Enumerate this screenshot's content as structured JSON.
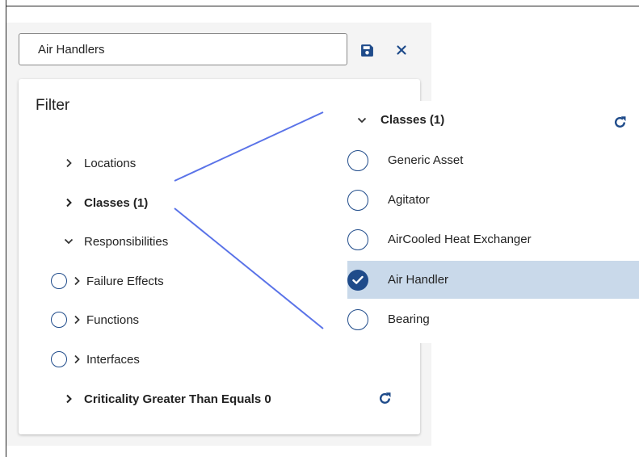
{
  "search": {
    "value": "Air Handlers"
  },
  "toolbar": {
    "save_icon": "save-icon",
    "close_icon": "close-icon"
  },
  "filter": {
    "title": "Filter",
    "items": [
      {
        "label": "Locations",
        "state": "collapsed"
      },
      {
        "label": "Classes (1)",
        "state": "collapsed",
        "bold": true
      },
      {
        "label": "Responsibilities",
        "state": "expanded"
      },
      {
        "label": "Failure Effects",
        "radio": true
      },
      {
        "label": "Functions",
        "radio": true
      },
      {
        "label": "Interfaces",
        "radio": true
      },
      {
        "label": "Criticality Greater Than Equals 0",
        "state": "collapsed",
        "bold": true
      }
    ]
  },
  "classes_popup": {
    "header": "Classes (1)",
    "options": [
      {
        "label": "Generic Asset",
        "selected": false
      },
      {
        "label": "Agitator",
        "selected": false
      },
      {
        "label": "AirCooled Heat Exchanger",
        "selected": false
      },
      {
        "label": "Air Handler",
        "selected": true
      },
      {
        "label": "Bearing",
        "selected": false
      }
    ]
  },
  "colors": {
    "accent": "#1f4b8a",
    "selected_row": "#c9d9ea",
    "connector": "#5a73e8",
    "panel_bg": "#f4f4f4"
  }
}
